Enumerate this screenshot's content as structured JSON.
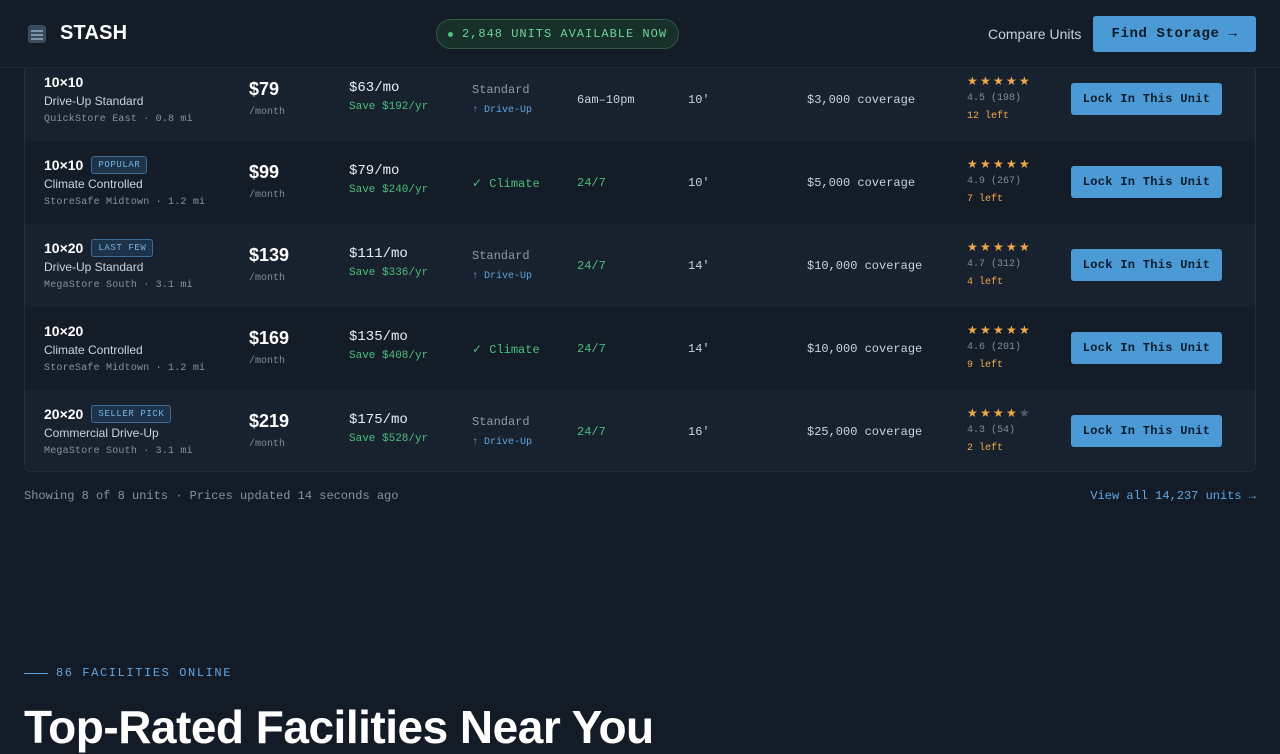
{
  "header": {
    "brand": "STASH",
    "brand_icon": "storage-building-icon",
    "availability": "2,848 UNITS AVAILABLE NOW",
    "compare_label": "Compare Units",
    "find_label": "Find Storage",
    "find_arrow": "→"
  },
  "units": [
    {
      "size": "10×10",
      "badge": "",
      "type": "Drive-Up Standard",
      "facility": "QuickStore East · 0.8 mi",
      "price": "$79",
      "per": "/month",
      "promo": "$63/mo",
      "save": "Save $192/yr",
      "feature": "Standard",
      "feature_sub": "↑ Drive-Up",
      "climate": false,
      "hours": "6am–10pm",
      "hours_open": false,
      "height": "10'",
      "coverage": "$3,000 coverage",
      "rating_stars": 5,
      "rating": "4.5 (198)",
      "left": "12 left",
      "cta": "Lock In This Unit"
    },
    {
      "size": "10×10",
      "badge": "POPULAR",
      "type": "Climate Controlled",
      "facility": "StoreSafe Midtown · 1.2 mi",
      "price": "$99",
      "per": "/month",
      "promo": "$79/mo",
      "save": "Save $240/yr",
      "feature": "✓ Climate",
      "feature_sub": "",
      "climate": true,
      "hours": "24/7",
      "hours_open": true,
      "height": "10'",
      "coverage": "$5,000 coverage",
      "rating_stars": 5,
      "rating": "4.9 (267)",
      "left": "7 left",
      "cta": "Lock In This Unit"
    },
    {
      "size": "10×20",
      "badge": "LAST FEW",
      "type": "Drive-Up Standard",
      "facility": "MegaStore South · 3.1 mi",
      "price": "$139",
      "per": "/month",
      "promo": "$111/mo",
      "save": "Save $336/yr",
      "feature": "Standard",
      "feature_sub": "↑ Drive-Up",
      "climate": false,
      "hours": "24/7",
      "hours_open": true,
      "height": "14'",
      "coverage": "$10,000 coverage",
      "rating_stars": 5,
      "rating": "4.7 (312)",
      "left": "4 left",
      "cta": "Lock In This Unit"
    },
    {
      "size": "10×20",
      "badge": "",
      "type": "Climate Controlled",
      "facility": "StoreSafe Midtown · 1.2 mi",
      "price": "$169",
      "per": "/month",
      "promo": "$135/mo",
      "save": "Save $408/yr",
      "feature": "✓ Climate",
      "feature_sub": "",
      "climate": true,
      "hours": "24/7",
      "hours_open": true,
      "height": "14'",
      "coverage": "$10,000 coverage",
      "rating_stars": 5,
      "rating": "4.6 (201)",
      "left": "9 left",
      "cta": "Lock In This Unit"
    },
    {
      "size": "20×20",
      "badge": "SELLER PICK",
      "type": "Commercial Drive-Up",
      "facility": "MegaStore South · 3.1 mi",
      "price": "$219",
      "per": "/month",
      "promo": "$175/mo",
      "save": "Save $528/yr",
      "feature": "Standard",
      "feature_sub": "↑ Drive-Up",
      "climate": false,
      "hours": "24/7",
      "hours_open": true,
      "height": "16'",
      "coverage": "$25,000 coverage",
      "rating_stars": 4,
      "rating": "4.3 (54)",
      "left": "2 left",
      "cta": "Lock In This Unit"
    }
  ],
  "footer": {
    "note": "Showing 8 of 8 units · Prices updated 14 seconds ago",
    "view_all": "View all 14,237 units →"
  },
  "section": {
    "eyebrow": "86 FACILITIES ONLINE",
    "title": "Top-Rated Facilities Near You"
  },
  "colors": {
    "accent": "#4b9ad6",
    "success": "#4cbf7a",
    "star": "#f0a94a",
    "background": "#131b26"
  }
}
